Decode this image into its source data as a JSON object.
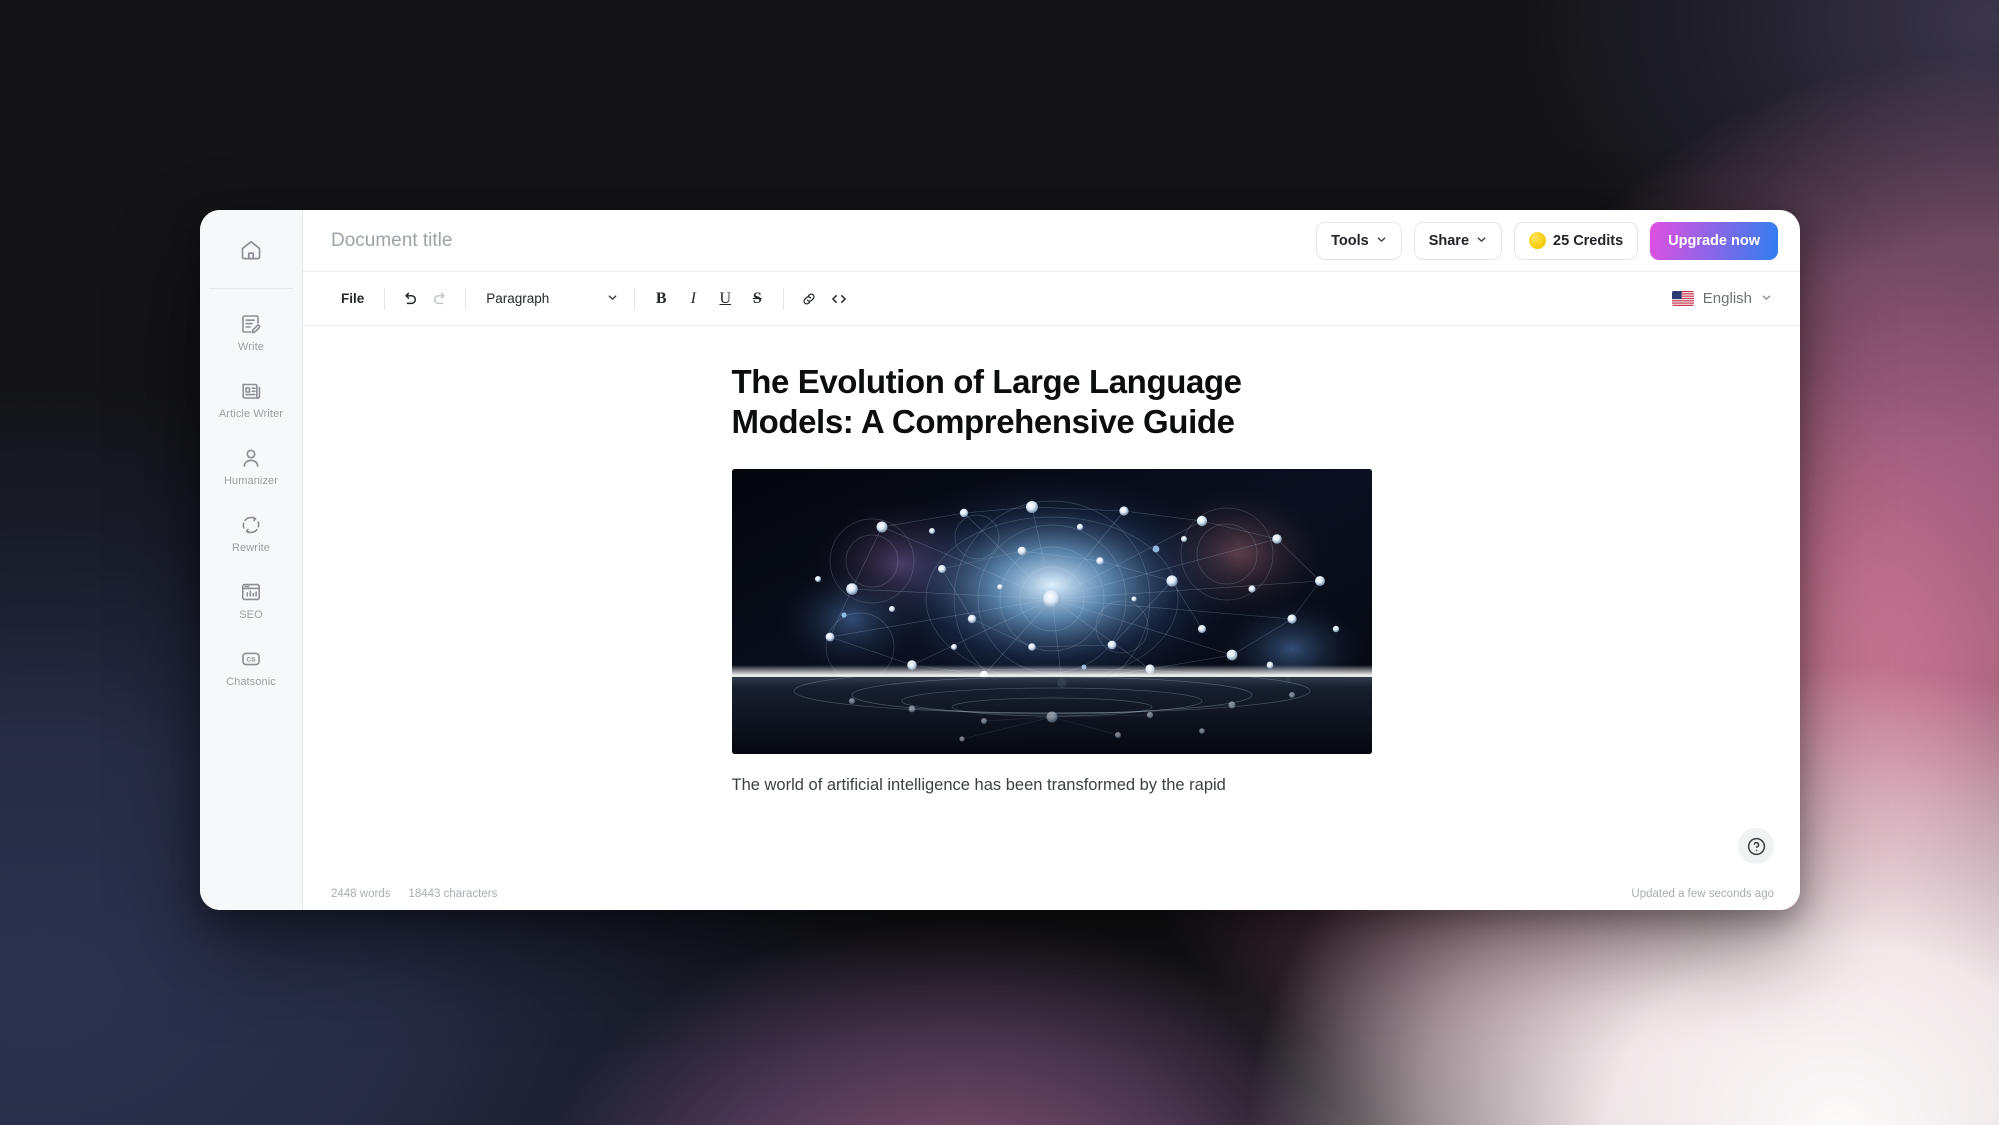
{
  "window": {
    "header": {
      "doc_title_placeholder": "Document title",
      "doc_title_value": "",
      "tools_label": "Tools",
      "share_label": "Share",
      "credits_label": "25 Credits",
      "credits_count": 25,
      "upgrade_label": "Upgrade now",
      "coin_color": "#F7D012",
      "upgrade_gradient_from": "#E14FE0",
      "upgrade_gradient_to": "#2F7FF0"
    },
    "toolbar": {
      "file_label": "File",
      "undo_icon": "undo-icon",
      "redo_icon": "redo-icon",
      "paragraph_label": "Paragraph",
      "bold_label": "B",
      "italic_label": "I",
      "underline_label": "U",
      "strikethrough_label": "S",
      "link_icon": "link-icon",
      "code_icon": "code-icon",
      "language_label": "English",
      "language_flag": "us-flag-icon"
    },
    "sidebar": {
      "home_icon": "home-icon",
      "items": [
        {
          "label": "Write",
          "icon": "write-document-icon"
        },
        {
          "label": "Article Writer",
          "icon": "article-icon"
        },
        {
          "label": "Humanizer",
          "icon": "person-icon"
        },
        {
          "label": "Rewrite",
          "icon": "refresh-circle-icon"
        },
        {
          "label": "SEO",
          "icon": "seo-chart-icon"
        },
        {
          "label": "Chatsonic",
          "icon": "chatsonic-cs-icon"
        }
      ]
    },
    "editor": {
      "heading": "The Evolution of Large Language Models: A Comprehensive Guide",
      "image_alt": "Abstract cosmic neural network of glowing blue and white nodes connected by light filaments, reflected over a mirrored horizon",
      "paragraph": "The world of artificial intelligence has been transformed by the rapid"
    },
    "footer": {
      "word_count": "2448 words",
      "character_count": "18443 characters",
      "updated_status": "Updated a few seconds ago"
    },
    "help": {
      "icon": "question-mark-circle-icon"
    }
  }
}
